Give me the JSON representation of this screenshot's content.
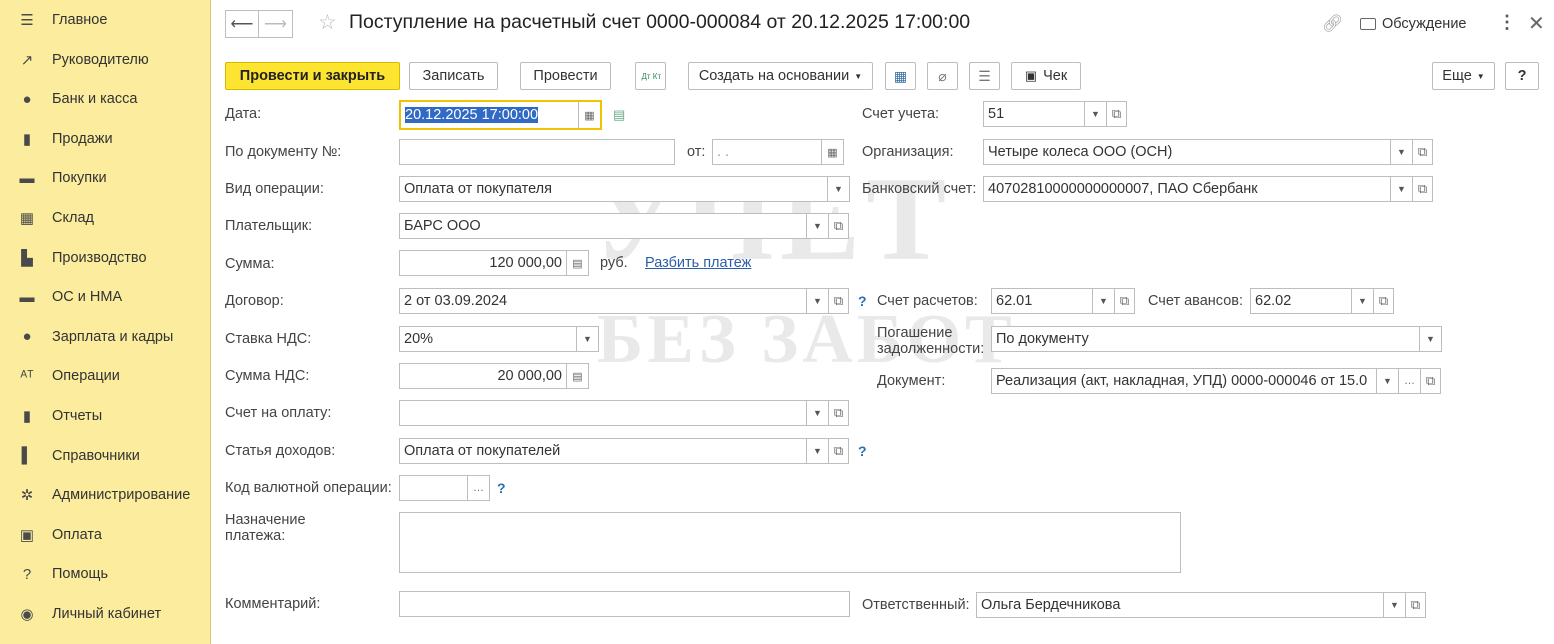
{
  "sidebar": {
    "items": [
      {
        "label": "Главное",
        "icon": "menu-icon"
      },
      {
        "label": "Руководителю",
        "icon": "trend-icon"
      },
      {
        "label": "Банк и касса",
        "icon": "ruble-coin-icon"
      },
      {
        "label": "Продажи",
        "icon": "shopping-bag-icon"
      },
      {
        "label": "Покупки",
        "icon": "cart-icon"
      },
      {
        "label": "Склад",
        "icon": "warehouse-icon"
      },
      {
        "label": "Производство",
        "icon": "factory-icon"
      },
      {
        "label": "ОС и НМА",
        "icon": "truck-icon"
      },
      {
        "label": "Зарплата и кадры",
        "icon": "person-icon"
      },
      {
        "label": "Операции",
        "icon": "dt-kt-icon"
      },
      {
        "label": "Отчеты",
        "icon": "bar-chart-icon"
      },
      {
        "label": "Справочники",
        "icon": "book-icon"
      },
      {
        "label": "Администрирование",
        "icon": "gear-icon"
      },
      {
        "label": "Оплата",
        "icon": "payment-icon"
      },
      {
        "label": "Помощь",
        "icon": "question-icon"
      },
      {
        "label": "Личный кабинет",
        "icon": "account-icon"
      }
    ]
  },
  "header": {
    "title": "Поступление на расчетный счет 0000-000084 от 20.12.2025 17:00:00",
    "discussion": "Обсуждение"
  },
  "toolbar": {
    "post_close": "Провести и закрыть",
    "save": "Записать",
    "post": "Провести",
    "dtkt": "Дт Кт",
    "create_based": "Создать на основании",
    "check": "Чек",
    "more": "Еще",
    "help": "?"
  },
  "form": {
    "date_label": "Дата:",
    "date_value": "20.12.2025 17:00:00",
    "doc_no_label": "По документу №:",
    "doc_from_label": "от:",
    "doc_from_placeholder": " .  .",
    "op_type_label": "Вид операции:",
    "op_type_value": "Оплата от покупателя",
    "payer_label": "Плательщик:",
    "payer_value": "БАРС ООО",
    "sum_label": "Сумма:",
    "sum_value": "120 000,00",
    "currency": "руб.",
    "split_link": "Разбить платеж",
    "contract_label": "Договор:",
    "contract_value": "2 от 03.09.2024",
    "vat_rate_label": "Ставка НДС:",
    "vat_rate_value": "20%",
    "vat_sum_label": "Сумма НДС:",
    "vat_sum_value": "20 000,00",
    "invoice_label": "Счет на оплату:",
    "income_label": "Статья доходов:",
    "income_value": "Оплата от покупателей",
    "currency_op_label": "Код валютной операции:",
    "purpose_label": "Назначение платежа:",
    "comment_label": "Комментарий:",
    "account_label": "Счет учета:",
    "account_value": "51",
    "org_label": "Организация:",
    "org_value": "Четыре колеса ООО (ОСН)",
    "bank_label": "Банковский счет:",
    "bank_value": "40702810000000000007, ПАО Сбербанк",
    "settle_label": "Счет расчетов:",
    "settle_value": "62.01",
    "advance_label": "Счет авансов:",
    "advance_value": "62.02",
    "repay_label": "Погашение задолженности:",
    "repay_value": "По документу",
    "document_label": "Документ:",
    "document_value": "Реализация (акт, накладная, УПД) 0000-000046 от 15.0",
    "responsible_label": "Ответственный:",
    "responsible_value": "Ольга Бердечникова"
  },
  "watermark": {
    "line1": "УЧЕТ",
    "line2": "БЕЗ ЗАБОТ"
  }
}
